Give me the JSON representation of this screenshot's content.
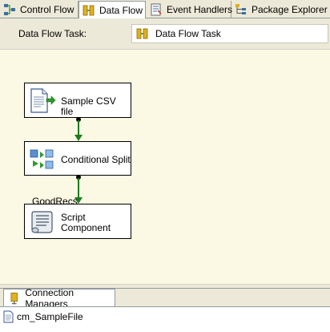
{
  "tabs": [
    {
      "label": "Control Flow",
      "icon": "control-flow-icon",
      "active": false
    },
    {
      "label": "Data Flow",
      "icon": "data-flow-icon",
      "active": true
    },
    {
      "label": "Event Handlers",
      "icon": "event-handlers-icon",
      "active": false
    },
    {
      "label": "Package Explorer",
      "icon": "package-explorer-icon",
      "active": false
    }
  ],
  "task_selector": {
    "label": "Data Flow Task:",
    "value": "Data Flow Task",
    "icon": "data-flow-task-icon"
  },
  "canvas": {
    "components": [
      {
        "name": "Sample CSV file",
        "icon": "flat-file-source-icon"
      },
      {
        "name": "Conditional Split",
        "icon": "conditional-split-icon"
      },
      {
        "name_line1": "Script",
        "name_line2": "Component",
        "icon": "script-component-icon"
      }
    ],
    "path_label": "GoodRecs",
    "path_color": "#1e7b1e"
  },
  "connection_managers": {
    "tab_label": "Connection Managers",
    "items": [
      {
        "name": "cm_SampleFile",
        "icon": "flat-file-connection-icon"
      }
    ]
  }
}
